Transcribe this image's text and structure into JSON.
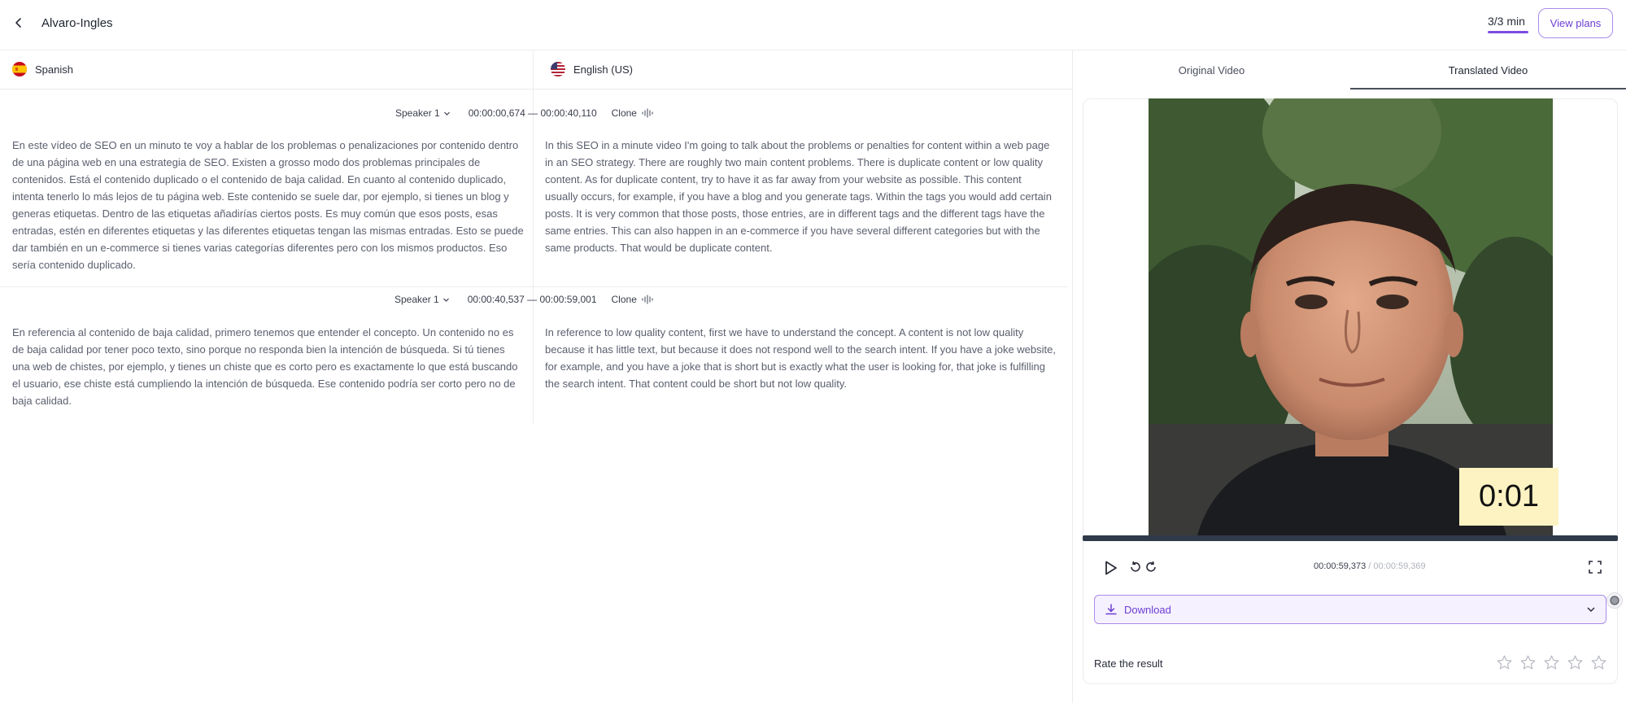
{
  "header": {
    "title": "Alvaro-Ingles",
    "usage": "3/3 min",
    "view_plans_label": "View plans"
  },
  "languages": {
    "source": {
      "name": "Spanish",
      "flag": "spain-flag-icon"
    },
    "target": {
      "name": "English (US)",
      "flag": "usa-flag-icon"
    }
  },
  "segments": [
    {
      "speaker": "Speaker 1",
      "timecode": "00:00:00,674 — 00:00:40,110",
      "clone_label": "Clone",
      "source_text": "En este vídeo de SEO en un minuto te voy a hablar de los problemas o penalizaciones por contenido dentro de una página web en una estrategia de SEO. Existen a grosso modo dos problemas principales de contenidos. Está el contenido duplicado o el contenido de baja calidad. En cuanto al contenido duplicado, intenta tenerlo lo más lejos de tu página web. Este contenido se suele dar, por ejemplo, si tienes un blog y generas etiquetas. Dentro de las etiquetas añadirías ciertos posts. Es muy común que esos posts, esas entradas, estén en diferentes etiquetas y las diferentes etiquetas tengan las mismas entradas. Esto se puede dar también en un e-commerce si tienes varias categorías diferentes pero con los mismos productos. Eso sería contenido duplicado.",
      "target_text": "In this SEO in a minute video I'm going to talk about the problems or penalties for content within a web page in an SEO strategy. There are roughly two main content problems. There is duplicate content or low quality content. As for duplicate content, try to have it as far away from your website as possible. This content usually occurs, for example, if you have a blog and you generate tags. Within the tags you would add certain posts. It is very common that those posts, those entries, are in different tags and the different tags have the same entries. This can also happen in an e-commerce if you have several different categories but with the same products. That would be duplicate content."
    },
    {
      "speaker": "Speaker 1",
      "timecode": "00:00:40,537 — 00:00:59,001",
      "clone_label": "Clone",
      "source_text": "En referencia al contenido de baja calidad, primero tenemos que entender el concepto. Un contenido no es de baja calidad por tener poco texto, sino porque no responda bien la intención de búsqueda. Si tú tienes una web de chistes, por ejemplo, y tienes un chiste que es corto pero es exactamente lo que está buscando el usuario, ese chiste está cumpliendo la intención de búsqueda. Ese contenido podría ser corto pero no de baja calidad.",
      "target_text": "In reference to low quality content, first we have to understand the concept. A content is not low quality because it has little text, but because it does not respond well to the search intent. If you have a joke website, for example, and you have a joke that is short but is exactly what the user is looking for, that joke is fulfilling the search intent. That content could be short but not low quality."
    }
  ],
  "video_panel": {
    "tabs": [
      {
        "label": "Original Video",
        "active": false
      },
      {
        "label": "Translated Video",
        "active": true
      }
    ],
    "overlay_timer": "0:01",
    "current_time": "00:00:59,373",
    "separator": " / ",
    "total_time": "00:00:59,369",
    "download_label": "Download",
    "rate_label": "Rate the result",
    "rating": {
      "value": 0,
      "max": 5
    }
  },
  "colors": {
    "accent": "#7c4de1",
    "accent_text": "#6b3fd4",
    "timer_bg": "#fdf3c2",
    "progress_track": "#2f3a4a"
  }
}
